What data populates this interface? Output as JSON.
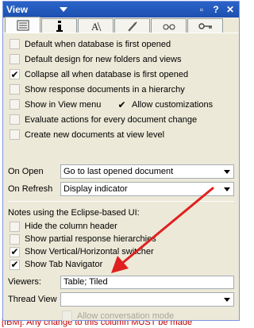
{
  "window": {
    "title": "View",
    "buttons": {
      "pin": "▫",
      "help": "?",
      "close": "✕"
    }
  },
  "tabs": [
    {
      "icon": "list-icon"
    },
    {
      "icon": "info-icon"
    },
    {
      "icon": "font-icon"
    },
    {
      "icon": "rocket-icon"
    },
    {
      "icon": "eyeglasses-icon"
    },
    {
      "icon": "key-icon"
    }
  ],
  "options": {
    "default_open": {
      "label": "Default when database is first opened",
      "checked": false
    },
    "default_design": {
      "label": "Default design for new folders and views",
      "checked": false
    },
    "collapse_all": {
      "label": "Collapse all when database is first opened",
      "checked": true
    },
    "response_hierarchy": {
      "label": "Show response documents in a hierarchy",
      "checked": false
    },
    "show_in_menu": {
      "label": "Show in View menu",
      "checked": false
    },
    "allow_custom": {
      "label": "Allow customizations",
      "checked": true
    },
    "evaluate_actions": {
      "label": "Evaluate actions for every document change",
      "checked": false
    },
    "create_new_docs": {
      "label": "Create new documents at view level",
      "checked": false
    }
  },
  "on_open": {
    "label": "On Open",
    "value": "Go to last opened document"
  },
  "on_refresh": {
    "label": "On Refresh",
    "value": "Display indicator"
  },
  "eclipse": {
    "heading": "Notes using the Eclipse-based UI:",
    "hide_header": {
      "label": "Hide the column header",
      "checked": false
    },
    "partial_hier": {
      "label": "Show partial response hierarchies",
      "checked": false
    },
    "switcher": {
      "label": "Show Vertical/Horizontal switcher",
      "checked": true
    },
    "tab_nav": {
      "label": "Show Tab Navigator",
      "checked": true
    }
  },
  "viewers": {
    "label": "Viewers:",
    "value": "Table; Tiled"
  },
  "thread_view": {
    "label": "Thread View",
    "value": ""
  },
  "allow_conversation": {
    "label": "Allow conversation mode",
    "checked": false
  },
  "background_text": "[IBM]: Any change to this column MUST be made",
  "colors": {
    "titlebar": "#1c4fb0",
    "arrow": "#e02020",
    "panel": "#ece9d8"
  }
}
